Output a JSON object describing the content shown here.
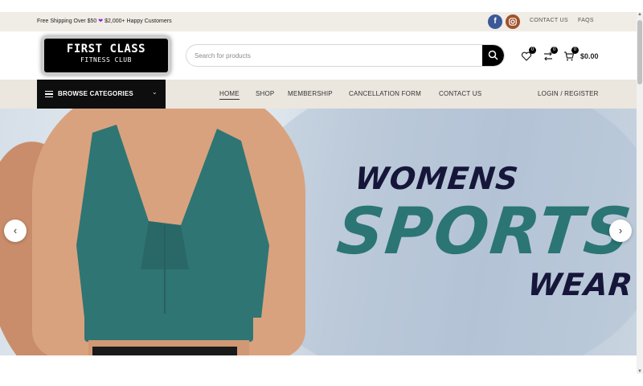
{
  "topbar": {
    "promo_text": "Free Shipping Over $50",
    "promo_text_2": "$2,000+ Happy Customers",
    "links": {
      "contact": "CONTACT US",
      "faqs": "FAQS"
    },
    "social": {
      "facebook_icon": "f"
    }
  },
  "header": {
    "logo": {
      "line1": "FIRST CLASS",
      "line2": "FITNESS CLUB"
    },
    "search": {
      "placeholder": "Search for products"
    },
    "wishlist_count": "0",
    "compare_count": "0",
    "cart_count": "0",
    "cart_total": "$0.00"
  },
  "nav": {
    "categories_label": "BROWSE CATEGORIES",
    "items": [
      "HOME",
      "SHOP",
      "MEMBERSHIP",
      "CANCELLATION FORM",
      "CONTACT US"
    ],
    "login": "LOGIN / REGISTER"
  },
  "hero": {
    "line1": "WOMENS",
    "line2": "SPORTS",
    "line3": "WEAR"
  },
  "colors": {
    "accent_teal": "#2b7575",
    "navy": "#16163a",
    "topbar_bg": "#f0ece6",
    "nav_bg": "#ebe6de",
    "facebook": "#3b5998",
    "instagram": "#a0522d"
  },
  "icons": [
    "facebook-icon",
    "instagram-icon",
    "search-icon",
    "heart-icon",
    "compare-icon",
    "cart-icon",
    "menu-icon",
    "chevron-down-icon",
    "chevron-left-icon",
    "chevron-right-icon"
  ]
}
